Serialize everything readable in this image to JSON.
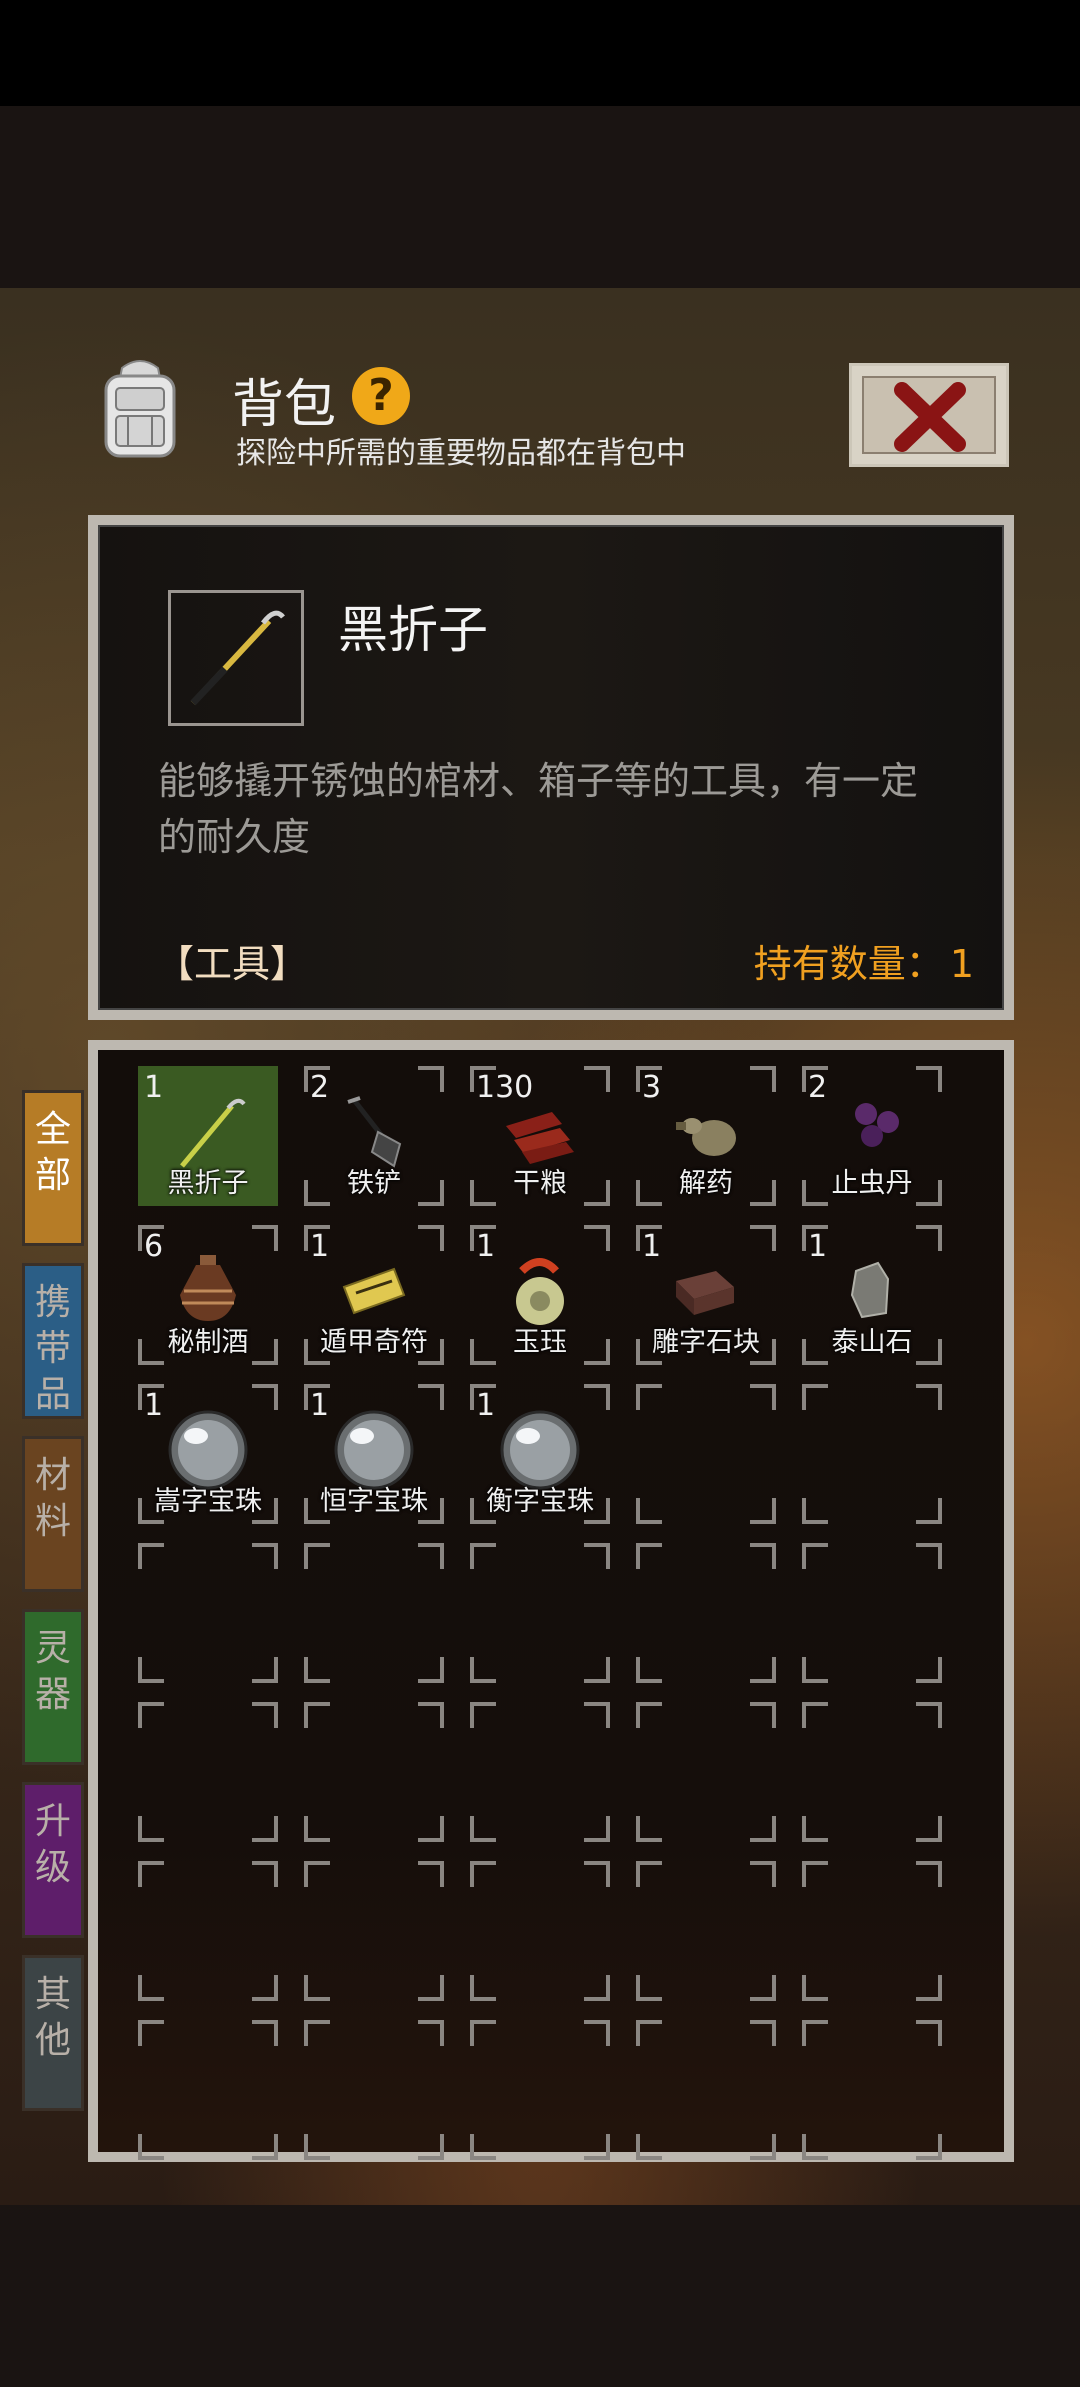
{
  "header": {
    "title": "背包",
    "help_glyph": "?",
    "subtitle": "探险中所需的重要物品都在背包中"
  },
  "detail": {
    "name": "黑折子",
    "description": "能够撬开锈蚀的棺材、箱子等的工具，有一定的耐久度",
    "category": "【工具】",
    "count_label": "持有数量：",
    "count_value": "1"
  },
  "tabs": [
    {
      "label": "全部",
      "color": "#b67c26"
    },
    {
      "label": "携带品",
      "color": "#2b5e86"
    },
    {
      "label": "材料",
      "color": "#6a4420"
    },
    {
      "label": "灵器",
      "color": "#2f6a2c"
    },
    {
      "label": "升级",
      "color": "#5e1e6a"
    },
    {
      "label": "其他",
      "color": "#3c4446"
    }
  ],
  "items": [
    {
      "qty": "1",
      "name": "黑折子",
      "icon": "crowbar-icon",
      "selected": true
    },
    {
      "qty": "2",
      "name": "铁铲",
      "icon": "shovel-icon"
    },
    {
      "qty": "130",
      "name": "干粮",
      "icon": "dried-meat-icon"
    },
    {
      "qty": "3",
      "name": "解药",
      "icon": "antidote-gourd-icon"
    },
    {
      "qty": "2",
      "name": "止虫丹",
      "icon": "purple-pills-icon"
    },
    {
      "qty": "6",
      "name": "秘制酒",
      "icon": "wine-jar-icon"
    },
    {
      "qty": "1",
      "name": "遁甲奇符",
      "icon": "talisman-icon"
    },
    {
      "qty": "1",
      "name": "玉珏",
      "icon": "jade-dragon-icon"
    },
    {
      "qty": "1",
      "name": "雕字石块",
      "icon": "carved-stone-icon"
    },
    {
      "qty": "1",
      "name": "泰山石",
      "icon": "taishan-stone-icon"
    },
    {
      "qty": "1",
      "name": "嵩字宝珠",
      "icon": "pearl-icon"
    },
    {
      "qty": "1",
      "name": "恒字宝珠",
      "icon": "pearl-icon"
    },
    {
      "qty": "1",
      "name": "衡字宝珠",
      "icon": "pearl-icon"
    }
  ]
}
